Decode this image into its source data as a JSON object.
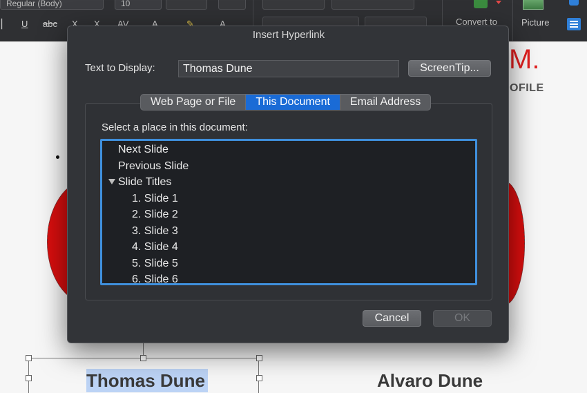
{
  "ribbon": {
    "font_name": "Regular (Body)",
    "font_size": "10",
    "convert_label": "Convert to",
    "picture_label": "Picture",
    "underline_glyph": "U",
    "strike_glyph": "abc",
    "sub_glyph": "X",
    "spacing_glyph": "AV",
    "color_glyph": "A",
    "grow_glyph": "A"
  },
  "slide": {
    "title_fragment": "M.",
    "subtitle_fragment": "OFILE",
    "name_left": "Thomas Dune",
    "name_right": "Alvaro Dune",
    "accent_red": "#d90e0e",
    "selection_highlight": "#bcd3f5"
  },
  "dialog": {
    "title": "Insert Hyperlink",
    "text_to_display_label": "Text to Display:",
    "text_to_display_value": "Thomas Dune",
    "screentip_label": "ScreenTip...",
    "tabs": [
      {
        "label": "Web Page or File",
        "active": false
      },
      {
        "label": "This Document",
        "active": true
      },
      {
        "label": "Email Address",
        "active": false
      }
    ],
    "select_place_label": "Select a place in this document:",
    "places": [
      {
        "label": "Next Slide",
        "level": 0,
        "disclosure": false
      },
      {
        "label": "Previous Slide",
        "level": 0,
        "disclosure": false
      },
      {
        "label": "Slide Titles",
        "level": 0,
        "disclosure": true
      },
      {
        "label": "1. Slide 1",
        "level": 1,
        "disclosure": false
      },
      {
        "label": "2. Slide 2",
        "level": 1,
        "disclosure": false
      },
      {
        "label": "3. Slide 3",
        "level": 1,
        "disclosure": false
      },
      {
        "label": "4. Slide 4",
        "level": 1,
        "disclosure": false
      },
      {
        "label": "5. Slide 5",
        "level": 1,
        "disclosure": false
      },
      {
        "label": "6. Slide 6",
        "level": 1,
        "disclosure": false
      }
    ],
    "cancel_label": "Cancel",
    "ok_label": "OK",
    "accent_blue": "#1a6bd6"
  }
}
